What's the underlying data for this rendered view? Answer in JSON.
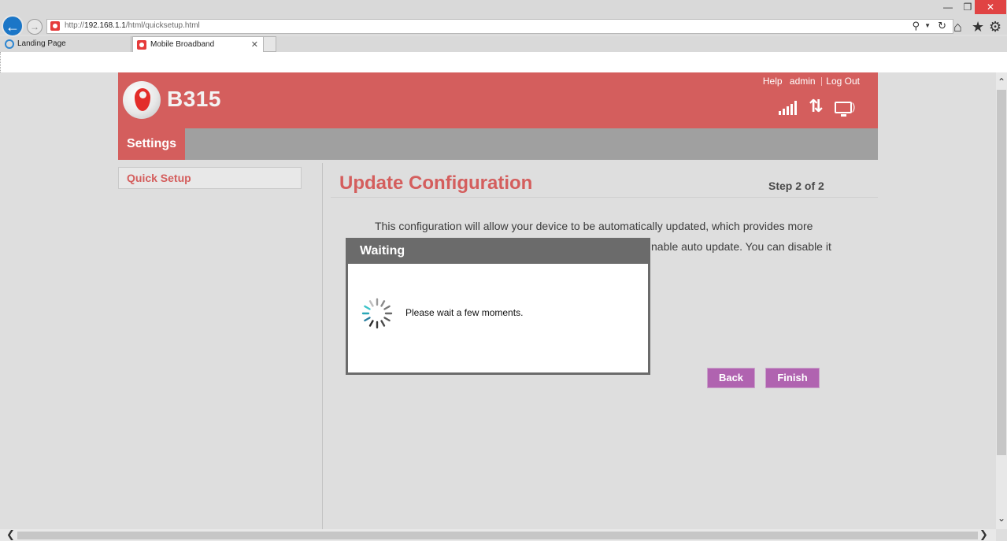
{
  "browser": {
    "url_prefix": "http://",
    "url_host": "192.168.1.1",
    "url_path": "/html/quicksetup.html",
    "tabs": [
      {
        "label": "Landing Page"
      },
      {
        "label": "Mobile Broadband"
      }
    ],
    "window_controls": {
      "minimize": "—",
      "restore": "❐",
      "close": "✕"
    },
    "icons": [
      "back-arrow-icon",
      "forward-arrow-icon",
      "search-icon",
      "refresh-icon",
      "home-icon",
      "star-icon",
      "gear-icon"
    ]
  },
  "header": {
    "model": "B315",
    "links": {
      "help": "Help",
      "user": "admin",
      "logout": "Log Out"
    },
    "brand_color": "#d45e5d"
  },
  "nav": {
    "settings": "Settings"
  },
  "sidebar": {
    "items": [
      {
        "label": "Quick Setup"
      }
    ]
  },
  "main": {
    "title": "Update Configuration",
    "step": "Step 2 of 2",
    "description_line1": "This configuration will allow your device to be automatically updated, which provides more",
    "description_line2": "nable auto update. You can disable it",
    "buttons": {
      "back": "Back",
      "finish": "Finish"
    },
    "button_color": "#b063b0"
  },
  "modal": {
    "title": "Waiting",
    "message": "Please wait a few moments."
  }
}
